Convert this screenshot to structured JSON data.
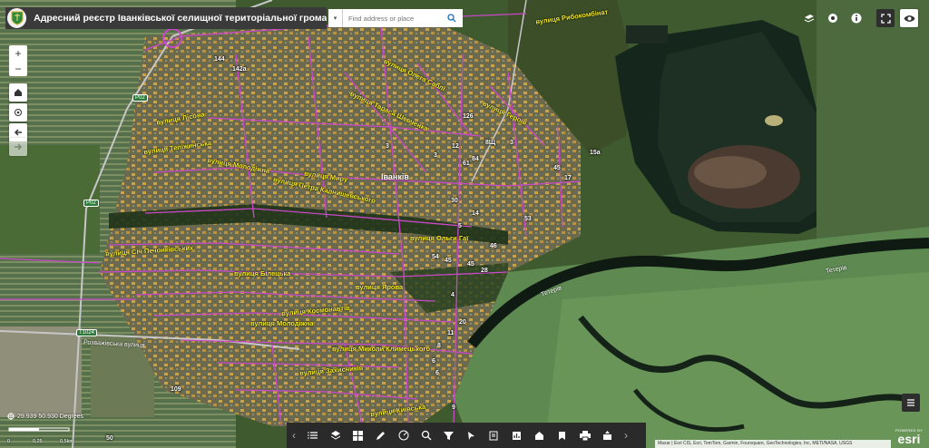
{
  "header": {
    "title": "Адресний реєстр Іванківської селищної територіальної громади"
  },
  "search": {
    "placeholder": "Find address or place"
  },
  "map": {
    "town_label": "Іванків",
    "streets": [
      "вулиця Рибокомбінат",
      "вулиця Лісова",
      "вулиця Теліжинська",
      "вулиця Молодіжна",
      "вулиця Миру",
      "вулиця Тараса Шевченка",
      "вулиця Олега Саблі",
      "вулиця Петра Калнишевського",
      "вулиця Ольги Гаї",
      "вулиця Січ Печонківських",
      "вулиця Білецька",
      "вулиця Ярова",
      "вулиця Космонавтів",
      "вулиця Молодіжна",
      "вулиця Миколи Климецького",
      "Розважівська вулиця",
      "вулиця Захисників",
      "вулиця Київська",
      "вулиця Героїв"
    ],
    "numbers": [
      "144",
      "142а",
      "126",
      "12",
      "3",
      "8Щ",
      "3",
      "15а",
      "84",
      "61",
      "45",
      "3",
      "17",
      "30",
      "5",
      "53",
      "46",
      "28",
      "45",
      "54",
      "45",
      "4",
      "20",
      "11",
      "6",
      "6",
      "109",
      "50",
      "9",
      "8",
      "14"
    ],
    "roads": [
      "Р02",
      "Р02",
      "Т1024",
      "Тетерів",
      "Тетерів"
    ],
    "river_label": "Тетерів"
  },
  "controls": {
    "zoom_in": "+",
    "zoom_out": "−"
  },
  "coordinates": {
    "readout": "29.939 50.930 Degrees"
  },
  "scale": {
    "labels": [
      "0",
      "0,25",
      "0,5km"
    ]
  },
  "attribution": "Maxar | Esri CIS, Esri, TomTom, Garmin, Foursquare, GeoTechnologies, Inc, METI/NASA, USGS",
  "esri": {
    "powered_by": "POWERED BY",
    "name": "esri"
  },
  "colors": {
    "header_bg": "#3a3a3a",
    "street_label": "#f7ef2a",
    "street_line": "#c948c9",
    "dock_bg": "#2a2a2a"
  }
}
